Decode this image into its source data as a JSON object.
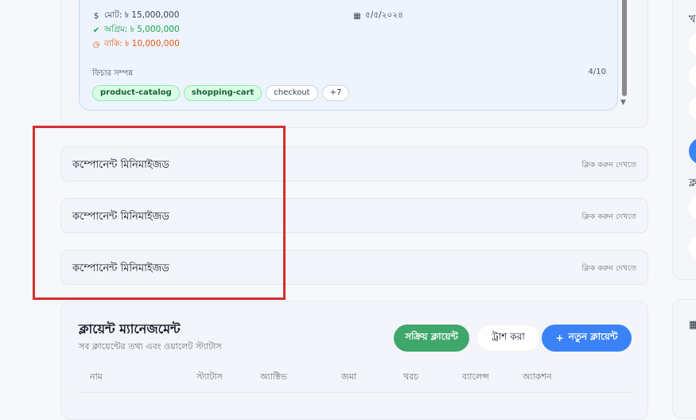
{
  "project": {
    "total": "মোট: ৳ 15,000,000",
    "advance": "অগ্রিম: ৳ 5,000,000",
    "due": "বাকি: ৳ 10,000,000",
    "date": "৫/৫/২০২৪",
    "features_label": "ফিচার সম্পন্ন",
    "features_count": "4/10",
    "tags": [
      "product-catalog",
      "shopping-cart",
      "checkout",
      "+7"
    ],
    "icons": {
      "total": "dollar-icon",
      "advance": "check-circle-icon",
      "due": "clock-icon",
      "date": "calendar-icon"
    }
  },
  "minimized": [
    {
      "label": "কম্পোনেন্ট মিনিমাইজড",
      "hint": "ক্লিক করুন দেখতে"
    },
    {
      "label": "কম্পোনেন্ট মিনিমাইজড",
      "hint": "ক্লিক করুন দেখতে"
    },
    {
      "label": "কম্পোনেন্ট মিনিমাইজড",
      "hint": "ক্লিক করুন দেখতে"
    }
  ],
  "clients": {
    "title": "ক্লায়েন্ট ম্যানেজমেন্ট",
    "subtitle": "সব ক্লায়েন্টের তথ্য এবং ওয়ালেট স্ট্যাটাস",
    "active_button": "সক্রিয় ক্লায়েন্ট",
    "trash_button": "ট্রাশ করা",
    "new_button": "নতুন ক্লায়েন্ট",
    "columns": [
      "নাম",
      "স্ট্যাটাস",
      "অ্যাক্টিভ",
      "জমা",
      "খরচ",
      "ব্যালেন্স",
      "অ্যাকশন"
    ]
  },
  "sidebar": {
    "glyph_a": "খ",
    "glyph_b": "ক্ল"
  },
  "colors": {
    "accent_blue": "#3b82f6",
    "accent_green": "#3fa76a",
    "highlight_red": "#d32f2f",
    "advance_green": "#16a34a",
    "due_orange": "#ea580c"
  }
}
